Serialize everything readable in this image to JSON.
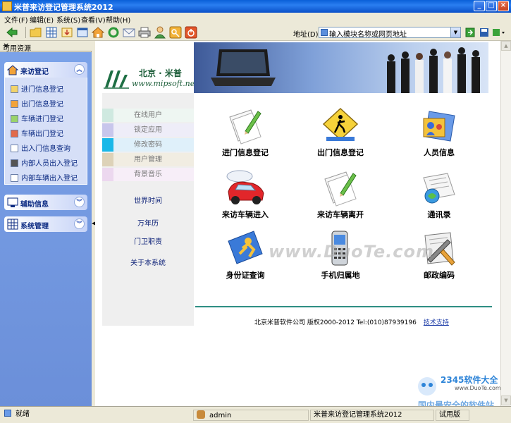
{
  "window": {
    "title": "米普来访登记管理系统2012"
  },
  "menu": [
    "文件(F)",
    "编辑(E)",
    "系统(S)",
    "查看(V)",
    "帮助(H)"
  ],
  "toolbar": {
    "address_label": "地址(D):",
    "address_value": "输入模块名称或网页地址",
    "icons": [
      "back-icon",
      "folder-icon",
      "grid-icon",
      "download-icon",
      "window-icon",
      "home-icon",
      "refresh-icon",
      "mail-icon",
      "printer-icon",
      "user-icon",
      "key-icon",
      "power-icon"
    ]
  },
  "left_panel": {
    "header": "可用资源",
    "groups": [
      {
        "label": "来访登记",
        "expanded": true,
        "items": [
          "进门信息登记",
          "出门信息登记",
          "车辆进门登记",
          "车辆出门登记",
          "出入门信息查询",
          "内部人员出入登记",
          "内部车辆出入登记"
        ]
      },
      {
        "label": "辅助信息",
        "expanded": false
      },
      {
        "label": "系统管理",
        "expanded": false
      }
    ]
  },
  "logo": {
    "cn": "北京 · 米普",
    "url": "www.mipsoft.net"
  },
  "side_nav": {
    "buttons": [
      {
        "label": "在线用户",
        "color": "#cfe9e0"
      },
      {
        "label": "锁定应用",
        "color": "#d2d0ec"
      },
      {
        "label": "修改密码",
        "color": "#c6e2f2"
      },
      {
        "label": "用户管理",
        "color": "#e2dccb"
      },
      {
        "label": "背景音乐",
        "color": "#ecd8ef"
      }
    ],
    "links": [
      "世界时间",
      "万年历",
      "门卫职责",
      "关于本系统"
    ]
  },
  "tiles": [
    {
      "label": "进门信息登记",
      "icon": "paper-pencil-icon"
    },
    {
      "label": "出门信息登记",
      "icon": "exit-sign-icon"
    },
    {
      "label": "人员信息",
      "icon": "people-card-icon"
    },
    {
      "label": "来访车辆进入",
      "icon": "red-car-icon"
    },
    {
      "label": "来访车辆离开",
      "icon": "paper-pencil-icon"
    },
    {
      "label": "通讯录",
      "icon": "address-book-icon"
    },
    {
      "label": "身份证查询",
      "icon": "id-card-icon"
    },
    {
      "label": "手机归属地",
      "icon": "mobile-phone-icon"
    },
    {
      "label": "邮政编码",
      "icon": "postal-icon"
    }
  ],
  "footer": {
    "text": "北京米普软件公司 版权2000-2012  Tel:(010)87939196",
    "link": "技术支持"
  },
  "watermarks": {
    "duote": "www.DuoTe.com",
    "site_a": "2345软件大全",
    "site_b": "www.DuoTe.com",
    "site_c": "国内最安全的软件站"
  },
  "status": {
    "ready": "就绪",
    "user": "admin",
    "app": "米普来访登记管理系统2012",
    "edition": "试用版"
  }
}
